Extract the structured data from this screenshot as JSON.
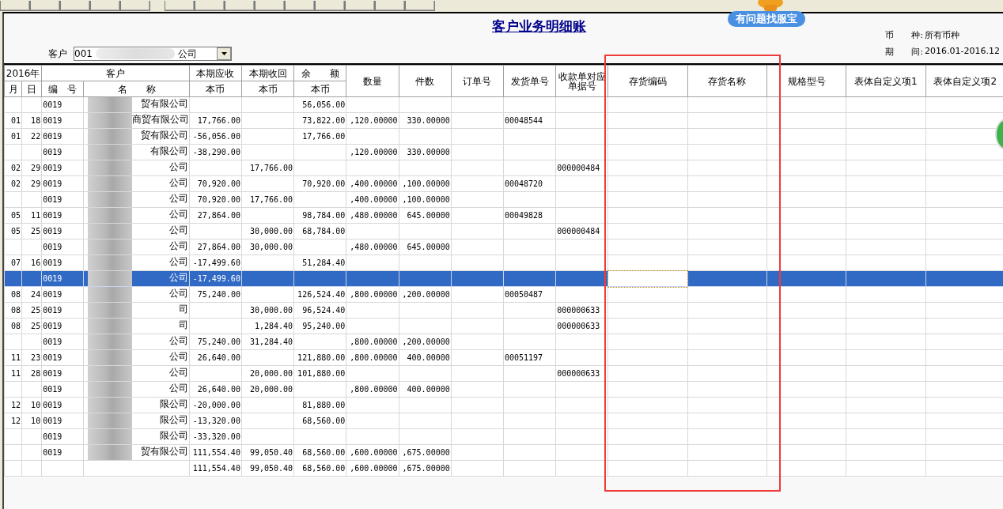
{
  "toolbar": [
    {
      "kind": "button"
    },
    {
      "kind": "button"
    },
    {
      "kind": "button"
    },
    {
      "kind": "button"
    },
    {
      "kind": "button"
    },
    {
      "kind": "separator"
    },
    {
      "kind": "button"
    },
    {
      "kind": "button"
    },
    {
      "kind": "button"
    },
    {
      "kind": "button"
    },
    {
      "kind": "button"
    },
    {
      "kind": "button"
    },
    {
      "kind": "button"
    },
    {
      "kind": "button"
    },
    {
      "kind": "button"
    }
  ],
  "help_badge": "有问题找服宝",
  "title": "客户业务明细账",
  "customer": {
    "label": "客户",
    "value_start": "001",
    "value_end": "公司"
  },
  "info": [
    {
      "label": "币　　种:",
      "value": "所有币种"
    },
    {
      "label": "期　　间:",
      "value": "2016.01-2016.12"
    }
  ],
  "columns": [
    {
      "label": "2016年",
      "children": [
        {
          "label": "月",
          "focused": false
        },
        {
          "label": "日",
          "focused": false
        }
      ]
    },
    {
      "label": "客户",
      "children": [
        {
          "label": "编　号",
          "focused": false
        },
        {
          "label": "名　　称",
          "focused": false
        }
      ]
    },
    {
      "label": "本期应收",
      "children": [
        {
          "label": "本币",
          "focused": false
        }
      ]
    },
    {
      "label": "本期收回",
      "children": [
        {
          "label": "本币",
          "focused": false
        }
      ]
    },
    {
      "label": "余　　额",
      "children": [
        {
          "label": "本币",
          "focused": false
        }
      ]
    },
    {
      "label": "数量",
      "focused": false
    },
    {
      "label": "件数",
      "focused": false
    },
    {
      "label": "订单号",
      "focused": false
    },
    {
      "label": "发货单号",
      "focused": false
    },
    {
      "label": "收款单对应单据号",
      "focused": false
    },
    {
      "label": "存货编码",
      "focused": true
    },
    {
      "label": "存货名称",
      "focused": false
    },
    {
      "label": "规格型号",
      "focused": false
    },
    {
      "label": "表体自定义项1",
      "focused": false
    },
    {
      "label": "表体自定义项2",
      "focused": false
    }
  ],
  "rows": [
    {
      "selected": false,
      "code": "0019",
      "name": "贸有限公司",
      "balance": "56,056.00"
    },
    {
      "selected": false,
      "month": "01",
      "day": "18",
      "code": "0019",
      "name": "商贸有限公司",
      "receivable": "17,766.00",
      "balance": "73,822.00",
      "quantity": ",120.00000",
      "pieces": "330.00000",
      "delivery_no": "00048544"
    },
    {
      "selected": false,
      "month": "01",
      "day": "22",
      "code": "0019",
      "name": "贸有限公司",
      "receivable": "-56,056.00",
      "balance": "17,766.00"
    },
    {
      "selected": false,
      "code": "0019",
      "name": "有限公司",
      "receivable": "-38,290.00",
      "quantity": ",120.00000",
      "pieces": "330.00000"
    },
    {
      "selected": false,
      "month": "02",
      "day": "29",
      "code": "0019",
      "name": "公司",
      "received": "17,766.00",
      "receipt_no": "000000484"
    },
    {
      "selected": false,
      "month": "02",
      "day": "29",
      "code": "0019",
      "name": "公司",
      "receivable": "70,920.00",
      "balance": "70,920.00",
      "quantity": ",400.00000",
      "pieces": ",100.00000",
      "delivery_no": "00048720"
    },
    {
      "selected": false,
      "code": "0019",
      "name": "公司",
      "receivable": "70,920.00",
      "received": "17,766.00",
      "quantity": ",400.00000",
      "pieces": ",100.00000"
    },
    {
      "selected": false,
      "month": "05",
      "day": "11",
      "code": "0019",
      "name": "公司",
      "receivable": "27,864.00",
      "balance": "98,784.00",
      "quantity": ",480.00000",
      "pieces": "645.00000",
      "delivery_no": "00049828"
    },
    {
      "selected": false,
      "month": "05",
      "day": "25",
      "code": "0019",
      "name": "公司",
      "received": "30,000.00",
      "balance": "68,784.00",
      "receipt_no": "000000484"
    },
    {
      "selected": false,
      "code": "0019",
      "name": "公司",
      "receivable": "27,864.00",
      "received": "30,000.00",
      "quantity": ",480.00000",
      "pieces": "645.00000"
    },
    {
      "selected": false,
      "month": "07",
      "day": "16",
      "code": "0019",
      "name": "公司",
      "receivable": "-17,499.60",
      "balance": "51,284.40"
    },
    {
      "selected": true,
      "code": "0019",
      "name": "公司",
      "receivable": "-17,499.60"
    },
    {
      "selected": false,
      "month": "08",
      "day": "24",
      "code": "0019",
      "name": "公司",
      "receivable": "75,240.00",
      "balance": "126,524.40",
      "quantity": ",800.00000",
      "pieces": ",200.00000",
      "delivery_no": "00050487"
    },
    {
      "selected": false,
      "month": "08",
      "day": "25",
      "code": "0019",
      "name": "司",
      "received": "30,000.00",
      "balance": "96,524.40",
      "receipt_no": "000000633"
    },
    {
      "selected": false,
      "month": "08",
      "day": "25",
      "code": "0019",
      "name": "司",
      "received": "1,284.40",
      "balance": "95,240.00",
      "receipt_no": "000000633"
    },
    {
      "selected": false,
      "code": "0019",
      "name": "公司",
      "receivable": "75,240.00",
      "received": "31,284.40",
      "quantity": ",800.00000",
      "pieces": ",200.00000"
    },
    {
      "selected": false,
      "month": "11",
      "day": "23",
      "code": "0019",
      "name": "公司",
      "receivable": "26,640.00",
      "balance": "121,880.00",
      "quantity": ",800.00000",
      "pieces": "400.00000",
      "delivery_no": "00051197"
    },
    {
      "selected": false,
      "month": "11",
      "day": "28",
      "code": "0019",
      "name": "公司",
      "received": "20,000.00",
      "balance": "101,880.00",
      "receipt_no": "000000633"
    },
    {
      "selected": false,
      "code": "0019",
      "name": "公司",
      "receivable": "26,640.00",
      "received": "20,000.00",
      "quantity": ",800.00000",
      "pieces": "400.00000"
    },
    {
      "selected": false,
      "month": "12",
      "day": "10",
      "code": "0019",
      "name": "限公司",
      "receivable": "-20,000.00",
      "balance": "81,880.00"
    },
    {
      "selected": false,
      "month": "12",
      "day": "10",
      "code": "0019",
      "name": "限公司",
      "receivable": "-13,320.00",
      "balance": "68,560.00"
    },
    {
      "selected": false,
      "code": "0019",
      "name": "限公司",
      "receivable": "-33,320.00"
    },
    {
      "selected": false,
      "code": "0019",
      "name": "贸有限公司",
      "receivable": "111,554.40",
      "received": "99,050.40",
      "balance": "68,560.00",
      "quantity": ",600.00000",
      "pieces": ",675.00000"
    },
    {
      "selected": false,
      "receivable": "111,554.40",
      "received": "99,050.40",
      "balance": "68,560.00",
      "quantity": ",600.00000",
      "pieces": ",675.00000"
    }
  ]
}
